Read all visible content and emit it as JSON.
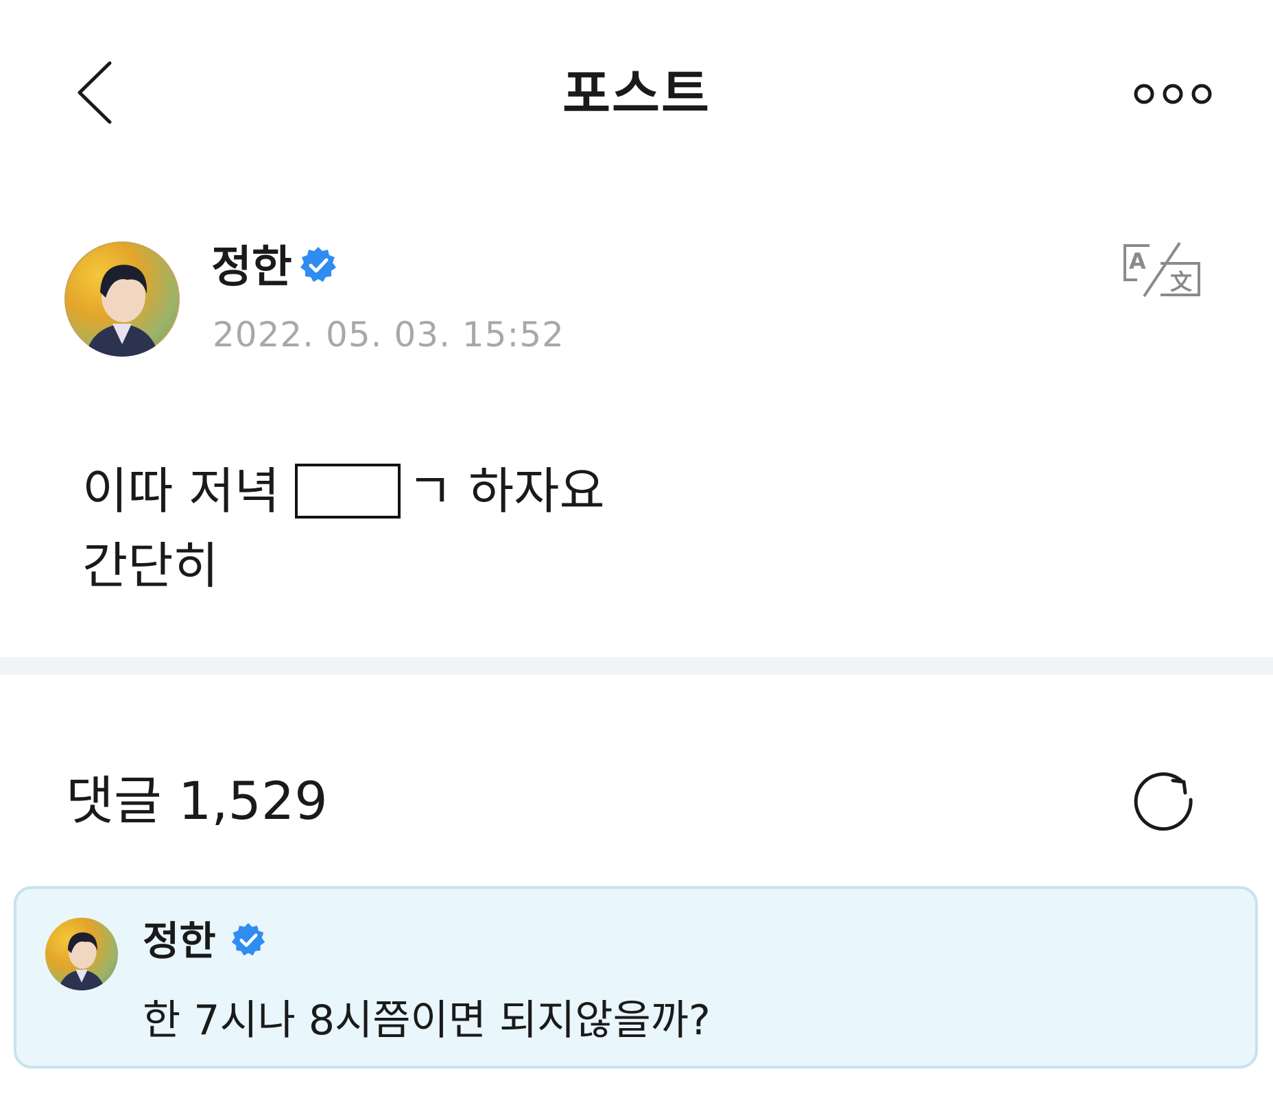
{
  "header": {
    "title": "포스트",
    "back_icon": "chevron-left-icon",
    "more_icon": "more-horizontal-icon"
  },
  "post": {
    "author": "정한",
    "verified_icon": "verified-badge-icon",
    "timestamp": "2022. 05. 03. 15:52",
    "translate_icon": "translate-icon",
    "line1_before": "이따 저녁",
    "line1_after": "ㄱ 하자요",
    "line2": "간단히"
  },
  "comments": {
    "label": "댓글 1,529",
    "refresh_icon": "refresh-icon"
  },
  "pinned_comment": {
    "author": "정한",
    "text": "한 7시나 8시쯤이면 되지않을까?"
  },
  "colors": {
    "verified": "#2f8cf0",
    "timestamp": "#a8a8a8",
    "comment_bg": "#e9f6fb",
    "comment_border": "#c7e3ee",
    "divider": "#f3f4f6"
  }
}
